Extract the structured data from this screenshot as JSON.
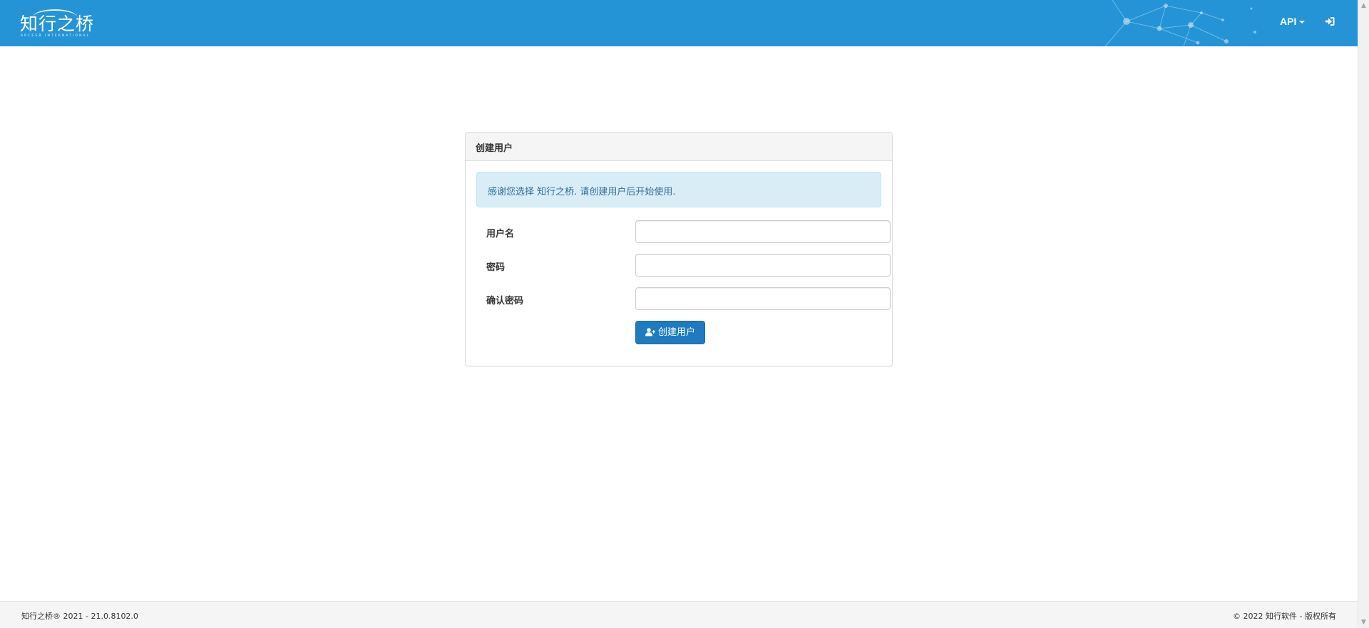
{
  "header": {
    "brand_name": "知行之桥",
    "brand_subtitle": "ARCESB INTERNATIONAL",
    "api_menu_label": "API",
    "background_color": "#2494d7",
    "login_icon": "sign-in-icon"
  },
  "panel": {
    "title": "创建用户",
    "alert_text": "感谢您选择 知行之桥. 请创建用户后开始使用.",
    "fields": [
      {
        "label": "用户名",
        "value": "",
        "placeholder": ""
      },
      {
        "label": "密码",
        "value": "",
        "placeholder": ""
      },
      {
        "label": "确认密码",
        "value": "",
        "placeholder": ""
      }
    ],
    "submit_label": "创建用户",
    "submit_icon": "user-plus-icon",
    "submit_color": "#1e7bbf"
  },
  "footer": {
    "left_text": "知行之桥® 2021 - 21.0.8102.0",
    "right_text": "© 2022 知行软件 - 版权所有"
  }
}
